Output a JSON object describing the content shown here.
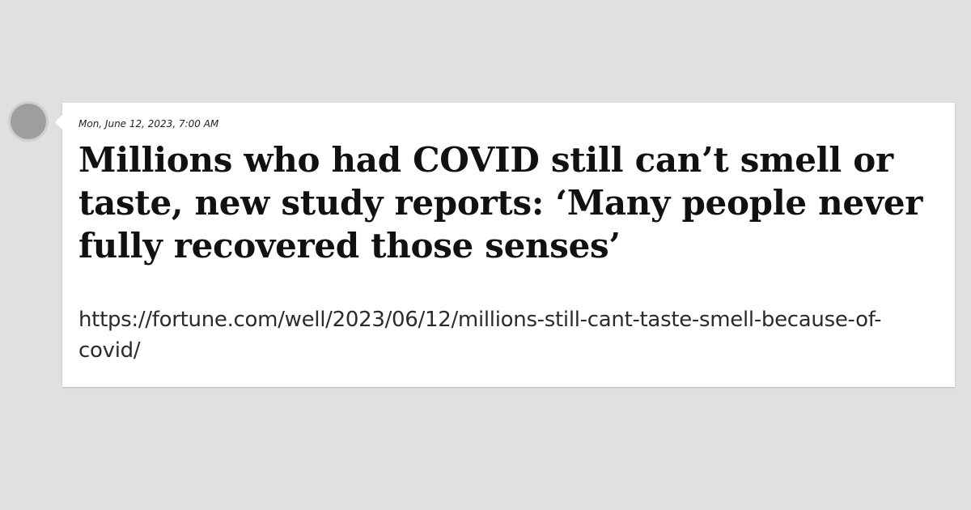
{
  "post": {
    "timestamp": "Mon, June 12, 2023, 7:00 AM",
    "headline": "Millions who had COVID still can’t smell or taste, new study reports: ‘Many people never fully recovered those senses’",
    "url": "https://fortune.com/well/2023/06/12/millions-still-cant-taste-smell-because-of-covid/"
  },
  "colors": {
    "background": "#e0e0e0",
    "card": "#ffffff",
    "avatar": "#9e9e9e",
    "text": "#111111"
  }
}
